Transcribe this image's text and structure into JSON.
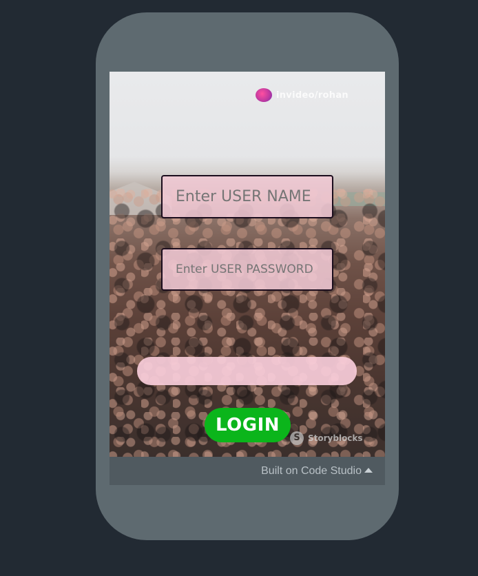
{
  "app": {
    "device_frame": "phone"
  },
  "overlay": {
    "watermark_text": "invideo/rohan",
    "stock_mark_letter": "S",
    "stock_mark_text": "Storyblocks"
  },
  "form": {
    "username_placeholder": "Enter USER NAME",
    "password_placeholder": "Enter USER PASSWORD",
    "message": "",
    "login_label": "LOGIN"
  },
  "footer": {
    "label": "Built on Code Studio",
    "icon": "caret-up-icon"
  },
  "colors": {
    "page_background": "#222a33",
    "device_frame": "#5e6a70",
    "field_fill": "#f0c8d4",
    "field_border": "#1b0d1d",
    "login_button": "#0bb51b",
    "footer_background": "#505a60"
  }
}
